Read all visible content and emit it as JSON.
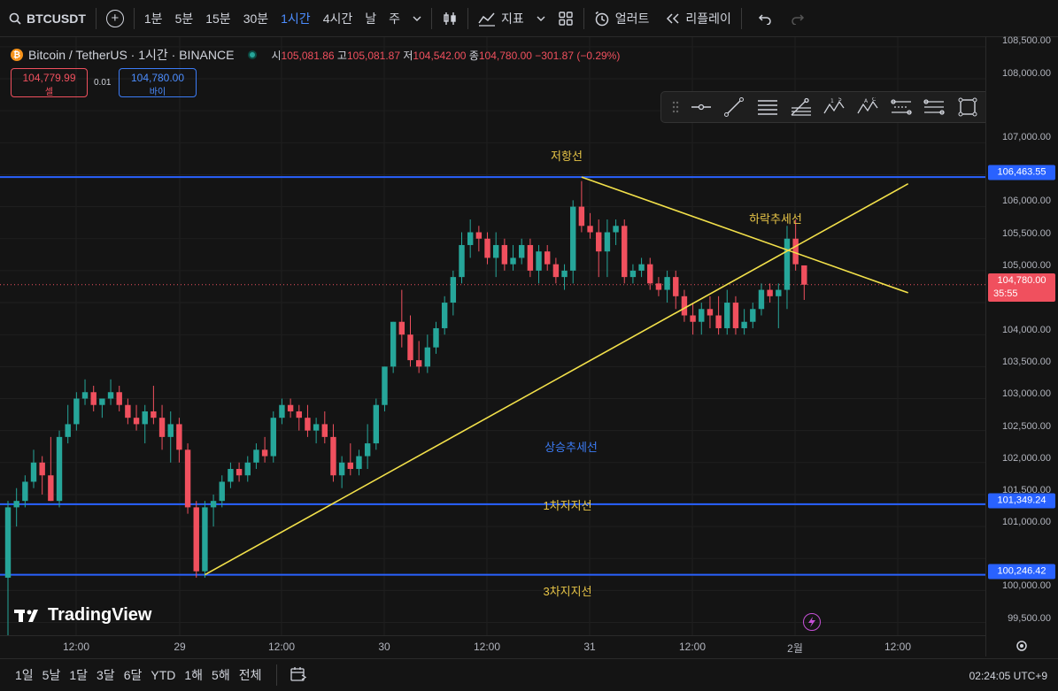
{
  "toolbar": {
    "symbol": "BTCUSDT",
    "intervals": [
      "1분",
      "5분",
      "15분",
      "30분",
      "1시간",
      "4시간",
      "날",
      "주"
    ],
    "active_interval": "1시간",
    "indicators_label": "지표",
    "alert_label": "얼러트",
    "replay_label": "리플레이"
  },
  "legend": {
    "title": "Bitcoin / TetherUS · 1시간 · BINANCE",
    "open_label": "시",
    "open": "105,081.86",
    "high_label": "고",
    "high": "105,081.87",
    "low_label": "저",
    "low": "104,542.00",
    "close_label": "종",
    "close": "104,780.00",
    "change": "−301.87 (−0.29%)"
  },
  "trade": {
    "sell_price": "104,779.99",
    "sell_label": "셀",
    "spread": "0.01",
    "buy_price": "104,780.00",
    "buy_label": "바이"
  },
  "annotations": {
    "resistance": "저항선",
    "downtrend": "하락추세선",
    "uptrend": "상승추세선",
    "support1": "1차지지선",
    "support3": "3차지지선"
  },
  "price_axis": {
    "ticks": [
      "108,500.00",
      "108,000.00",
      "107,000.00",
      "106,000.00",
      "105,500.00",
      "105,000.00",
      "104,000.00",
      "103,500.00",
      "103,000.00",
      "102,500.00",
      "102,000.00",
      "101,500.00",
      "101,000.00",
      "100,000.00",
      "99,500.00"
    ],
    "resistance_label": "106,463.55",
    "current_label": "104,780.00",
    "countdown": "35:55",
    "support1_label": "101,349.24",
    "support3_label": "100,246.42"
  },
  "time_axis": {
    "ticks": [
      "12:00",
      "29",
      "12:00",
      "30",
      "12:00",
      "31",
      "12:00",
      "2월",
      "12:00"
    ]
  },
  "bottom": {
    "ranges": [
      "1일",
      "5날",
      "1달",
      "3달",
      "6달",
      "YTD",
      "1해",
      "5해",
      "전체"
    ],
    "clock": "02:24:05 UTC+9"
  },
  "logo": "TradingView",
  "colors": {
    "up": "#26a69a",
    "down": "#f0505e",
    "level_line": "#2962ff",
    "trend_line": "#f2e04a",
    "annotation_yellow": "#e8c547",
    "annotation_blue": "#3c7cf6"
  },
  "chart_data": {
    "type": "candlestick",
    "timeframe": "1h",
    "ylim": [
      99300,
      108650
    ],
    "x_labels": [
      "12:00",
      "29",
      "12:00",
      "30",
      "12:00",
      "31",
      "12:00",
      "2월",
      "12:00"
    ],
    "candles": [
      [
        100200,
        101400,
        99200,
        101300
      ],
      [
        101300,
        101600,
        101000,
        101400
      ],
      [
        101400,
        101800,
        101300,
        101700
      ],
      [
        101700,
        102200,
        101600,
        102000
      ],
      [
        102000,
        102100,
        101500,
        101800
      ],
      [
        101800,
        102400,
        101400,
        101400
      ],
      [
        101400,
        102500,
        101300,
        102400
      ],
      [
        102400,
        102900,
        102300,
        102600
      ],
      [
        102600,
        103100,
        102500,
        103000
      ],
      [
        103000,
        103300,
        102900,
        103100
      ],
      [
        103100,
        103200,
        102800,
        102900
      ],
      [
        102900,
        103000,
        102700,
        103000
      ],
      [
        103000,
        103300,
        102900,
        103100
      ],
      [
        103100,
        103200,
        102800,
        102900
      ],
      [
        102900,
        103000,
        102600,
        102700
      ],
      [
        102700,
        102900,
        102500,
        102600
      ],
      [
        102600,
        102900,
        102300,
        102800
      ],
      [
        102800,
        103200,
        102600,
        102700
      ],
      [
        102700,
        102900,
        102200,
        102400
      ],
      [
        102400,
        102800,
        102000,
        102600
      ],
      [
        102600,
        102700,
        102000,
        102200
      ],
      [
        102200,
        102300,
        101200,
        101300
      ],
      [
        101300,
        101400,
        100200,
        100300
      ],
      [
        100300,
        101400,
        100200,
        101300
      ],
      [
        101300,
        101500,
        101000,
        101400
      ],
      [
        101400,
        101800,
        101300,
        101700
      ],
      [
        101700,
        102000,
        101600,
        101900
      ],
      [
        101900,
        102000,
        101700,
        101800
      ],
      [
        101800,
        102100,
        101700,
        102000
      ],
      [
        102000,
        102300,
        101900,
        102200
      ],
      [
        102200,
        102400,
        102000,
        102100
      ],
      [
        102100,
        102800,
        102000,
        102700
      ],
      [
        102700,
        103000,
        102600,
        102900
      ],
      [
        102900,
        103000,
        102700,
        102800
      ],
      [
        102800,
        102900,
        102500,
        102700
      ],
      [
        102700,
        102900,
        102400,
        102500
      ],
      [
        102500,
        102700,
        102300,
        102600
      ],
      [
        102600,
        102800,
        102300,
        102400
      ],
      [
        102400,
        102600,
        101700,
        101800
      ],
      [
        101800,
        102100,
        101600,
        102000
      ],
      [
        102000,
        102300,
        101800,
        101900
      ],
      [
        101900,
        102200,
        101800,
        102100
      ],
      [
        102100,
        102600,
        101900,
        102300
      ],
      [
        102300,
        103000,
        102200,
        102900
      ],
      [
        102900,
        103500,
        102800,
        103500
      ],
      [
        103500,
        104200,
        103400,
        104200
      ],
      [
        104200,
        104700,
        103800,
        104000
      ],
      [
        104000,
        104300,
        103500,
        103600
      ],
      [
        103600,
        103900,
        103400,
        103500
      ],
      [
        103500,
        104000,
        103400,
        103800
      ],
      [
        103800,
        104200,
        103700,
        104100
      ],
      [
        104100,
        104600,
        104000,
        104500
      ],
      [
        104500,
        105000,
        104300,
        104900
      ],
      [
        104900,
        105600,
        104800,
        105400
      ],
      [
        105400,
        105800,
        105200,
        105600
      ],
      [
        105600,
        105700,
        105300,
        105500
      ],
      [
        105500,
        105600,
        105100,
        105200
      ],
      [
        105200,
        105600,
        104900,
        105400
      ],
      [
        105400,
        105500,
        105000,
        105100
      ],
      [
        105100,
        105400,
        105000,
        105200
      ],
      [
        105200,
        105500,
        105100,
        105400
      ],
      [
        105400,
        105500,
        104900,
        105000
      ],
      [
        105000,
        105400,
        104800,
        105300
      ],
      [
        105300,
        105400,
        105000,
        105100
      ],
      [
        105100,
        105200,
        104800,
        104900
      ],
      [
        104900,
        105100,
        104700,
        105000
      ],
      [
        105000,
        106100,
        104800,
        106000
      ],
      [
        106000,
        106400,
        105600,
        105700
      ],
      [
        105700,
        105900,
        105500,
        105600
      ],
      [
        105600,
        105800,
        104900,
        105300
      ],
      [
        105300,
        105800,
        104900,
        105600
      ],
      [
        105600,
        105800,
        105400,
        105700
      ],
      [
        105700,
        105800,
        104800,
        104900
      ],
      [
        104900,
        105100,
        104800,
        105000
      ],
      [
        105000,
        105200,
        104900,
        105100
      ],
      [
        105100,
        105200,
        104700,
        104800
      ],
      [
        104800,
        104900,
        104600,
        104700
      ],
      [
        104700,
        105000,
        104500,
        104900
      ],
      [
        104900,
        105000,
        104400,
        104600
      ],
      [
        104600,
        104700,
        104200,
        104300
      ],
      [
        104300,
        104500,
        104000,
        104200
      ],
      [
        104200,
        104500,
        104000,
        104400
      ],
      [
        104400,
        104600,
        104100,
        104300
      ],
      [
        104300,
        104600,
        104000,
        104100
      ],
      [
        104100,
        104700,
        104000,
        104500
      ],
      [
        104500,
        104600,
        104000,
        104100
      ],
      [
        104100,
        104400,
        104000,
        104200
      ],
      [
        104200,
        104500,
        104100,
        104400
      ],
      [
        104400,
        104800,
        104300,
        104700
      ],
      [
        104700,
        104800,
        104500,
        104600
      ],
      [
        104600,
        104800,
        104100,
        104700
      ],
      [
        104700,
        105700,
        104400,
        105500
      ],
      [
        105500,
        105800,
        105000,
        105100
      ],
      [
        105081.86,
        105081.87,
        104542,
        104780
      ]
    ],
    "levels": [
      {
        "price": 106463.55,
        "label": "저항선"
      },
      {
        "price": 101349.24,
        "label": "1차지지선"
      },
      {
        "price": 100246.42,
        "label": "3차지지선"
      }
    ],
    "trendlines": [
      {
        "name": "하락추세선",
        "from": {
          "candle": 67,
          "price": 106463.55
        },
        "to": {
          "candle": 101,
          "price": 104850
        }
      },
      {
        "name": "상승추세선",
        "from": {
          "candle": 23,
          "price": 100246.42
        },
        "to": {
          "candle": 101,
          "price": 106050
        }
      }
    ],
    "current_price": 104780.0
  }
}
